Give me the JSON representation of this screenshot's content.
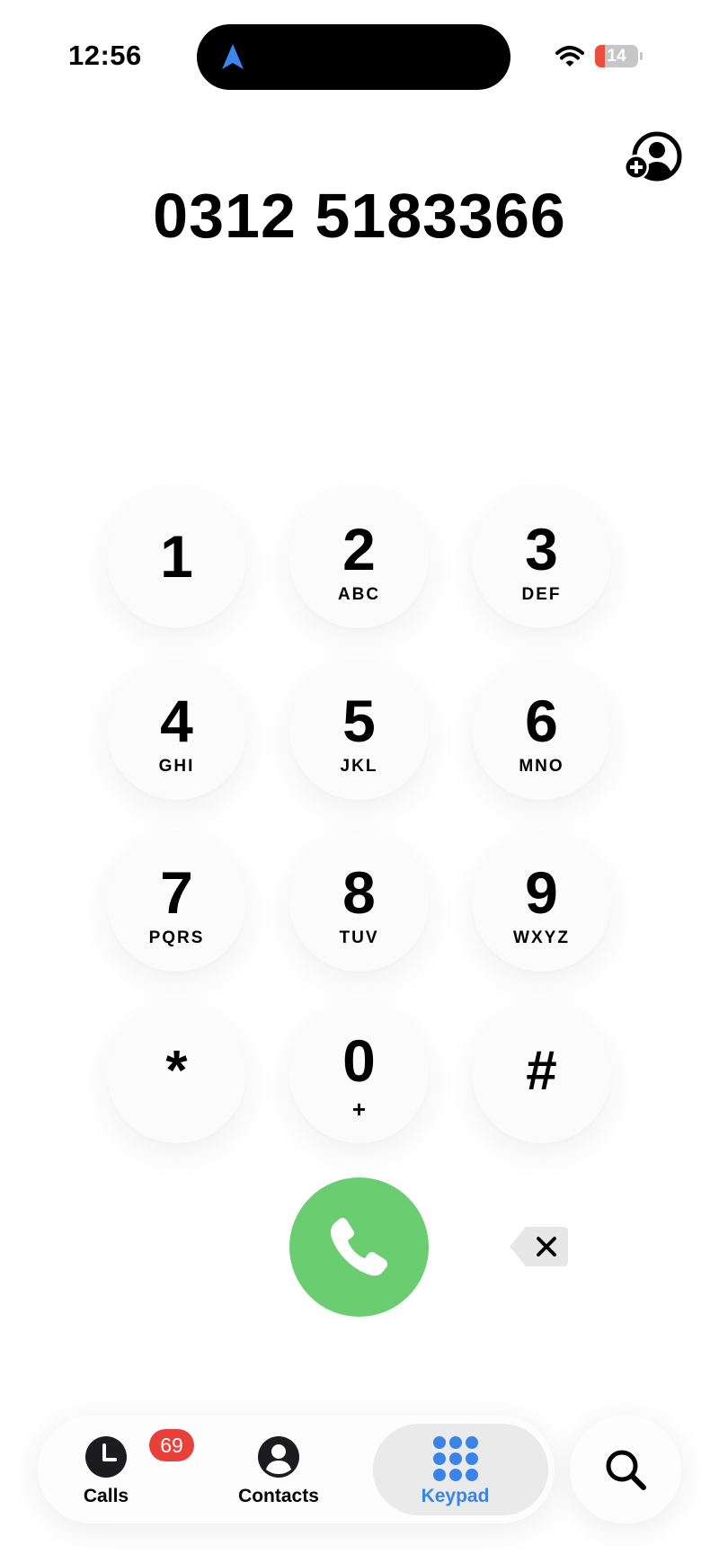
{
  "status_bar": {
    "time": "12:56",
    "battery_level": "14",
    "battery_fraction": 0.14,
    "battery_low_color": "#eb4e3d",
    "icons": [
      "location-arrow-icon",
      "wifi-icon",
      "battery-icon"
    ]
  },
  "display": {
    "number": "0312 5183366",
    "add_contact_icon": "add-contact-icon"
  },
  "keypad": {
    "keys": [
      {
        "digit": "1",
        "letters": ""
      },
      {
        "digit": "2",
        "letters": "ABC"
      },
      {
        "digit": "3",
        "letters": "DEF"
      },
      {
        "digit": "4",
        "letters": "GHI"
      },
      {
        "digit": "5",
        "letters": "JKL"
      },
      {
        "digit": "6",
        "letters": "MNO"
      },
      {
        "digit": "7",
        "letters": "PQRS"
      },
      {
        "digit": "8",
        "letters": "TUV"
      },
      {
        "digit": "9",
        "letters": "WXYZ"
      },
      {
        "digit": "*",
        "letters": ""
      },
      {
        "digit": "0",
        "letters": "+"
      },
      {
        "digit": "#",
        "letters": ""
      }
    ]
  },
  "actions": {
    "call_icon": "phone-icon",
    "call_color": "#6acd70",
    "delete_icon": "delete-backspace-icon"
  },
  "tab_bar": {
    "tabs": [
      {
        "label": "Calls",
        "icon": "clock-icon",
        "badge": "69"
      },
      {
        "label": "Contacts",
        "icon": "person-icon"
      },
      {
        "label": "Keypad",
        "icon": "keypad-grid-icon",
        "selected": true
      }
    ],
    "active_color": "#3a84e8",
    "badge_color": "#e8403a",
    "search_icon": "search-icon"
  }
}
